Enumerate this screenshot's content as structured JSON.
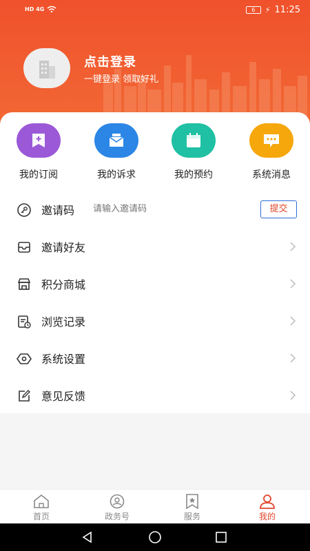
{
  "status_bar": {
    "left_icons": "HD 4G",
    "battery": "6",
    "time": "11:25"
  },
  "header": {
    "title": "点击登录",
    "subtitle": "一键登录  领取好礼",
    "avatar_icon": "building-icon",
    "bg_color": "#f0512c"
  },
  "quick_actions": [
    {
      "label": "我的订阅",
      "icon": "bookmark-plus-icon",
      "color": "#9b59d8"
    },
    {
      "label": "我的诉求",
      "icon": "envelope-icon",
      "color": "#2b86e6"
    },
    {
      "label": "我的预约",
      "icon": "calendar-icon",
      "color": "#1fc0a3"
    },
    {
      "label": "系统消息",
      "icon": "message-icon",
      "color": "#f5a70c"
    }
  ],
  "invite": {
    "label": "邀请码",
    "placeholder": "请输入邀请码",
    "submit": "提交",
    "icon": "key-icon"
  },
  "menu": [
    {
      "label": "邀请好友",
      "icon": "inbox-icon"
    },
    {
      "label": "积分商城",
      "icon": "store-icon"
    },
    {
      "label": "浏览记录",
      "icon": "history-icon"
    },
    {
      "label": "系统设置",
      "icon": "settings-icon"
    },
    {
      "label": "意见反馈",
      "icon": "edit-icon"
    }
  ],
  "tabs": [
    {
      "label": "首页",
      "icon": "home-icon",
      "active": false
    },
    {
      "label": "政务号",
      "icon": "eye-badge-icon",
      "active": false
    },
    {
      "label": "服务",
      "icon": "star-bookmark-icon",
      "active": false
    },
    {
      "label": "我的",
      "icon": "user-icon",
      "active": true
    }
  ],
  "accent_color": "#e0452a"
}
